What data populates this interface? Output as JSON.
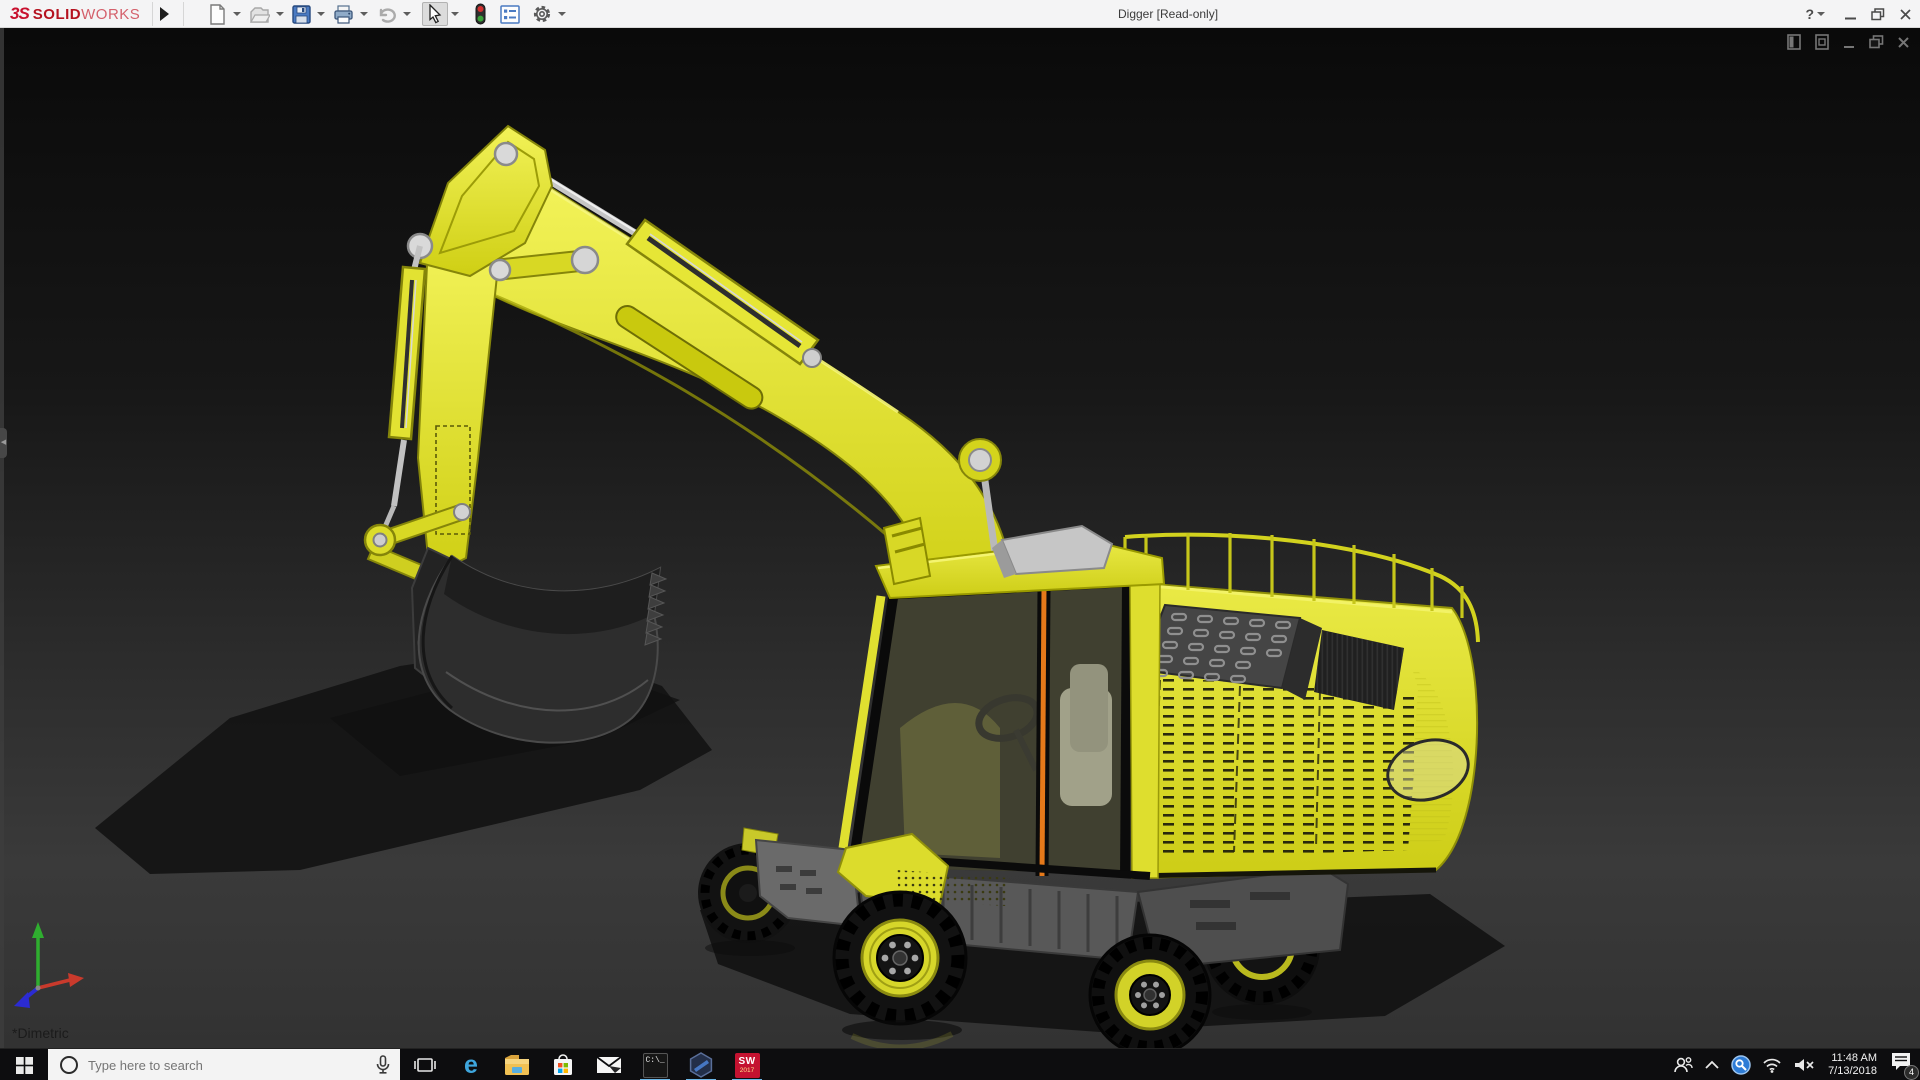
{
  "window": {
    "brand": {
      "ds_logo": "3S",
      "solid": "SOLID",
      "works": "WORKS"
    },
    "title": "Digger [Read-only]",
    "help_glyph": "?"
  },
  "toolbar": {
    "icons": [
      "new-document",
      "open",
      "save",
      "print",
      "undo",
      "select",
      "rebuild-traffic-light",
      "display-properties",
      "options-gear"
    ]
  },
  "viewport": {
    "view_label": "*Dimetric",
    "window_controls": [
      "feature-pane",
      "feature-pane-alt",
      "minimize",
      "restore",
      "close"
    ],
    "model_subject": "yellow wheeled excavator",
    "triad_axis_colors": {
      "x": "#c93a2c",
      "y": "#2fae2f",
      "z": "#2b2bd2"
    }
  },
  "taskbar": {
    "search": {
      "placeholder": "Type here to search"
    },
    "apps": [
      "task-view",
      "edge",
      "file-explorer",
      "store",
      "mail",
      "command-prompt",
      "edrawings",
      "solidworks-2017"
    ],
    "cmd_text": "C:\\",
    "solidworks_label": "SW",
    "solidworks_year": "2017",
    "tray": {
      "time": "11:48 AM",
      "date": "7/13/2018",
      "notification_count": "4"
    }
  },
  "colors": {
    "accent_yellow": "#dede2e",
    "brand_red": "#c8102e",
    "titlebar_bg": "#f4f4f5",
    "taskbar_bg": "#0d0d0f",
    "running_underline": "#6cb8e8"
  }
}
